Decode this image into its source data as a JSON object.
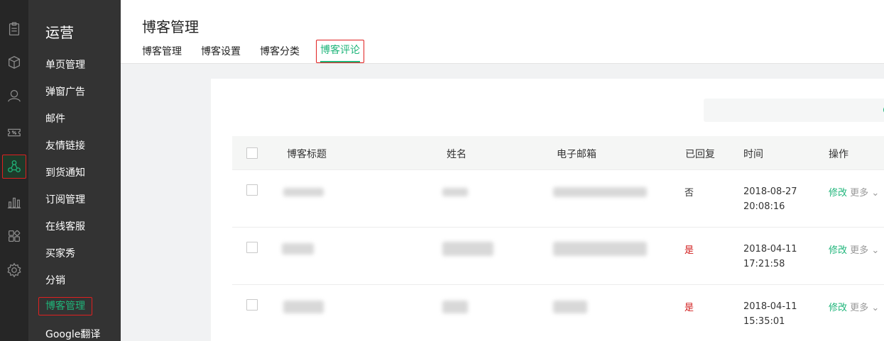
{
  "rail": {
    "icons": [
      "clipboard-icon",
      "box-icon",
      "user-icon",
      "coupon-icon",
      "network-icon",
      "bar-chart-icon",
      "apps-icon",
      "gear-icon"
    ]
  },
  "subnav": {
    "title": "运营",
    "items": [
      "单页管理",
      "弹窗广告",
      "邮件",
      "友情链接",
      "到货通知",
      "订阅管理",
      "在线客服",
      "买家秀",
      "分销",
      "博客管理",
      "Google翻译"
    ],
    "active_index": 9
  },
  "header": {
    "title": "博客管理",
    "tabs": [
      "博客管理",
      "博客设置",
      "博客分类",
      "博客评论"
    ],
    "active_tab": 3
  },
  "table": {
    "columns": [
      "博客标题",
      "姓名",
      "电子邮箱",
      "已回复",
      "时间",
      "操作"
    ],
    "rows": [
      {
        "replied": "否",
        "date": "2018-08-27",
        "time": "20:08:16",
        "edit": "修改",
        "more": "更多"
      },
      {
        "replied": "是",
        "date": "2018-04-11",
        "time": "17:21:58",
        "edit": "修改",
        "more": "更多"
      },
      {
        "replied": "是",
        "date": "2018-04-11",
        "time": "15:35:01",
        "edit": "修改",
        "more": "更多"
      }
    ]
  },
  "colors": {
    "accent": "#1fb57a",
    "highlight_border": "#e02020",
    "replied_yes": "#d11a1a"
  }
}
